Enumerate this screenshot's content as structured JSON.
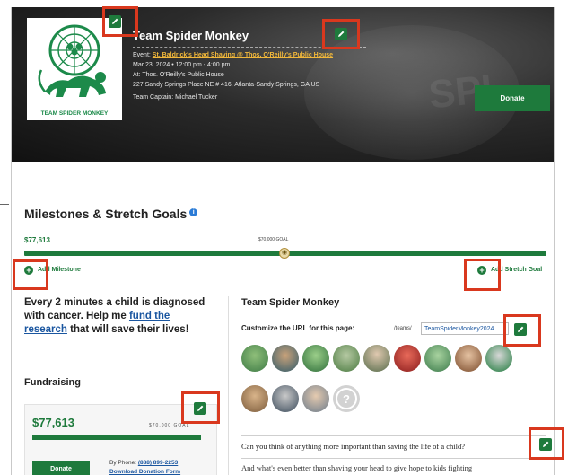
{
  "hero": {
    "team_name": "Team Spider Monkey",
    "event_prefix": "Event: ",
    "event_link": "St. Baldrick's Head Shaving @ Thos. O'Reilly's Public House",
    "date_time": "Mar 23, 2024 • 12:00 pm - 4:00 pm",
    "venue": "At: Thos. O'Reilly's Public House",
    "address": "227 Sandy Springs Place NE # 416, Atlanta-Sandy Springs, GA US",
    "captain": "Team Captain: Michael Tucker",
    "donate_label": "Donate",
    "logo_caption": "TEAM SPIDER MONKEY"
  },
  "milestones": {
    "title": "Milestones & Stretch Goals",
    "info_icon": "i",
    "amount": "$77,613",
    "goal_label": "$70,000 GOAL",
    "add_milestone": "Add Milestone",
    "add_stretch_goal": "Add Stretch Goal"
  },
  "left": {
    "tagline_1": "Every 2 minutes a child is diagnosed with cancer. Help me ",
    "tagline_link": "fund the research",
    "tagline_2": " that will save their lives!",
    "fundraising_title": "Fundraising",
    "fund_amount": "$77,613",
    "fund_goal": "$70,000 GOAL",
    "donate_label": "Donate",
    "phone_prefix": "By Phone: ",
    "phone_number": "(888) 899-2253",
    "download_form": "Download Donation Form"
  },
  "right": {
    "title": "Team Spider Monkey",
    "customize_label": "Customize the URL for this page:",
    "url_prefix": "/teams/",
    "url_value": "TeamSpiderMonkey2024",
    "question": "Can you think of anything more important than saving the life of a child?",
    "question_2": "And what's even better than shaving your head to give hope to kids fighting"
  },
  "icons": {
    "edit": "pencil-icon",
    "plus": "plus-circle-icon",
    "info": "info-circle-icon",
    "lock": "padlock-icon"
  },
  "colors": {
    "brand_green": "#1e7a3c",
    "highlight_red": "#d9381e",
    "link_gold": "#f2b83a",
    "link_blue": "#1a56a0"
  }
}
